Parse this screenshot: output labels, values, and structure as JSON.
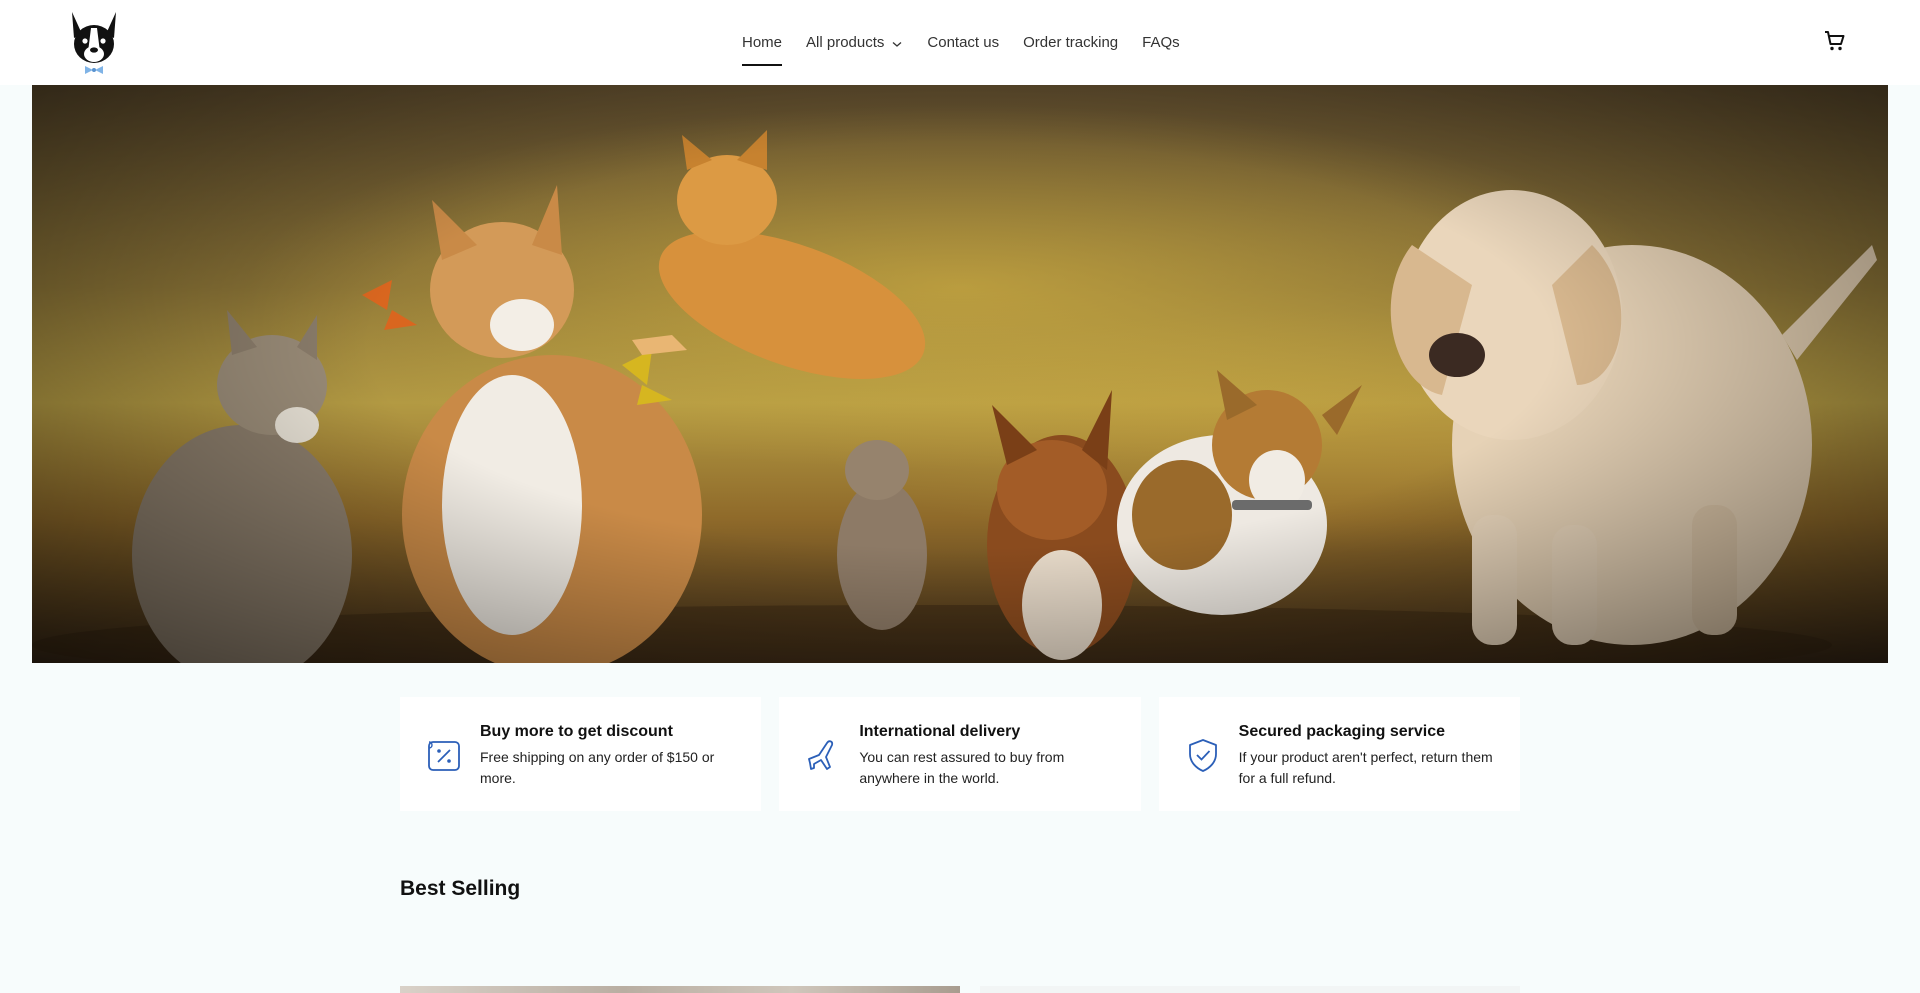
{
  "nav": {
    "items": [
      {
        "label": "Home",
        "active": true
      },
      {
        "label": "All products",
        "has_dropdown": true
      },
      {
        "label": "Contact us"
      },
      {
        "label": "Order tracking"
      },
      {
        "label": "FAQs"
      }
    ]
  },
  "icons": {
    "logo": "bulldog-logo-icon",
    "cart": "cart-icon",
    "chevron": "chevron-down-icon"
  },
  "hero": {
    "image": "cats-and-puppies-banner"
  },
  "features": [
    {
      "icon": "discount-icon",
      "title": "Buy more to get discount",
      "description": "Free shipping on any order of $150 or more."
    },
    {
      "icon": "airplane-icon",
      "title": "International delivery",
      "description": "You can rest assured to buy from anywhere in the world."
    },
    {
      "icon": "shield-check-icon",
      "title": "Secured packaging service",
      "description": "If your product aren't perfect, return them for a full refund."
    }
  ],
  "best_selling": {
    "title": "Best Selling"
  },
  "colors": {
    "accent": "#2b5fb8",
    "background": "#f7fcfc",
    "card": "#ffffff"
  }
}
